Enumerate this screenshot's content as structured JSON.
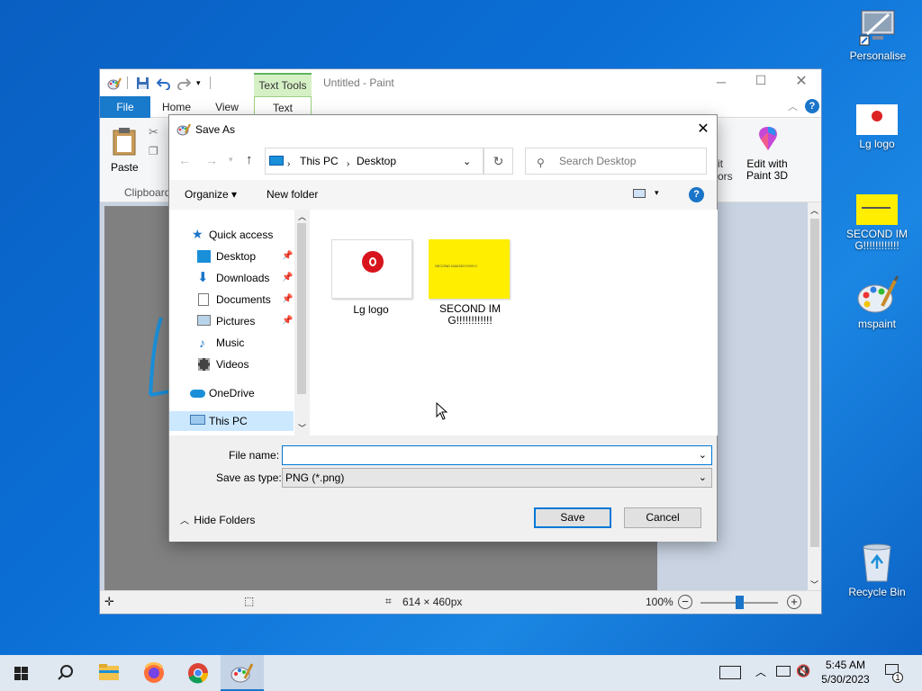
{
  "desktop": {
    "icons": [
      {
        "label": "Personalise"
      },
      {
        "label": "Lg logo"
      },
      {
        "label": "SECOND IMG!!!!!!!!!!!!"
      },
      {
        "label": "mspaint"
      },
      {
        "label": "Recycle Bin"
      }
    ]
  },
  "paint": {
    "title": "Untitled - Paint",
    "contextual_tab_group": "Text Tools",
    "tabs": {
      "file": "File",
      "home": "Home",
      "view": "View",
      "text": "Text"
    },
    "ribbon": {
      "paste": "Paste",
      "clipboard": "Clipboard",
      "edit_with": "Edit with",
      "paint3d": "Paint 3D",
      "partial": "it",
      "partial2": "ors"
    },
    "status": {
      "dimensions": "614 × 460px",
      "zoom": "100%"
    },
    "colors": {
      "file_tab": "#1979ca",
      "text_tools": "#d6f0c5"
    }
  },
  "dialog": {
    "title": "Save As",
    "breadcrumb": [
      "This PC",
      "Desktop"
    ],
    "search_placeholder": "Search Desktop",
    "organize": "Organize",
    "new_folder": "New folder",
    "tree": [
      {
        "label": "Quick access"
      },
      {
        "label": "Desktop"
      },
      {
        "label": "Downloads"
      },
      {
        "label": "Documents"
      },
      {
        "label": "Pictures"
      },
      {
        "label": "Music"
      },
      {
        "label": "Videos"
      },
      {
        "label": "OneDrive"
      },
      {
        "label": "This PC"
      }
    ],
    "files": [
      {
        "name": "Lg logo"
      },
      {
        "name": "SECOND IMG!!!!!!!!!!!!",
        "thumb_text": "SECOND IMAGE!!!!!!!!!!!!!!"
      }
    ],
    "file_name_label": "File name:",
    "file_name_value": "",
    "save_type_label": "Save as type:",
    "save_type_value": "PNG (*.png)",
    "hide_folders": "Hide Folders",
    "save": "Save",
    "cancel": "Cancel"
  },
  "taskbar": {
    "time": "5:45 AM",
    "date": "5/30/2023",
    "notification_count": "1"
  }
}
